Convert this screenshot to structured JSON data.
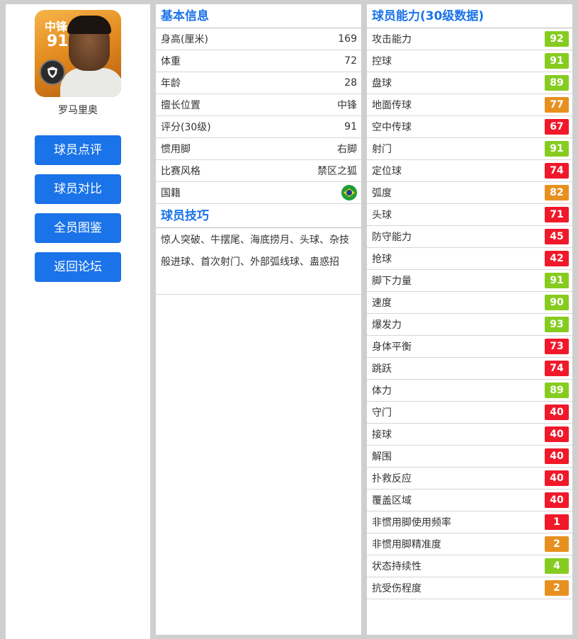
{
  "player": {
    "position": "中锋",
    "rating": "91",
    "name": "罗马里奥"
  },
  "nav": [
    {
      "label": "球员点评"
    },
    {
      "label": "球员对比"
    },
    {
      "label": "全员图鉴"
    },
    {
      "label": "返回论坛"
    }
  ],
  "basic": {
    "title": "基本信息",
    "rows": [
      {
        "label": "身高(厘米)",
        "value": "169"
      },
      {
        "label": "体重",
        "value": "72"
      },
      {
        "label": "年龄",
        "value": "28"
      },
      {
        "label": "擅长位置",
        "value": "中锋"
      },
      {
        "label": "评分(30级)",
        "value": "91"
      },
      {
        "label": "惯用脚",
        "value": "右脚"
      },
      {
        "label": "比赛风格",
        "value": "禁区之狐"
      },
      {
        "label": "国籍",
        "value": ""
      }
    ]
  },
  "skills": {
    "title": "球员技巧",
    "text": "惊人突破、牛摆尾、海底捞月、头球、杂技般进球、首次射门、外部弧线球、蛊惑招"
  },
  "abilities": {
    "title": "球员能力(30级数据)",
    "colors": {
      "green": "#86cc20",
      "orange": "#e8901f",
      "red": "#f1182a"
    },
    "rows": [
      {
        "label": "攻击能力",
        "value": "92",
        "color": "green"
      },
      {
        "label": "控球",
        "value": "91",
        "color": "green"
      },
      {
        "label": "盘球",
        "value": "89",
        "color": "green"
      },
      {
        "label": "地面传球",
        "value": "77",
        "color": "orange"
      },
      {
        "label": "空中传球",
        "value": "67",
        "color": "red"
      },
      {
        "label": "射门",
        "value": "91",
        "color": "green"
      },
      {
        "label": "定位球",
        "value": "74",
        "color": "red"
      },
      {
        "label": "弧度",
        "value": "82",
        "color": "orange"
      },
      {
        "label": "头球",
        "value": "71",
        "color": "red"
      },
      {
        "label": "防守能力",
        "value": "45",
        "color": "red"
      },
      {
        "label": "抢球",
        "value": "42",
        "color": "red"
      },
      {
        "label": "脚下力量",
        "value": "91",
        "color": "green"
      },
      {
        "label": "速度",
        "value": "90",
        "color": "green"
      },
      {
        "label": "爆发力",
        "value": "93",
        "color": "green"
      },
      {
        "label": "身体平衡",
        "value": "73",
        "color": "red"
      },
      {
        "label": "跳跃",
        "value": "74",
        "color": "red"
      },
      {
        "label": "体力",
        "value": "89",
        "color": "green"
      },
      {
        "label": "守门",
        "value": "40",
        "color": "red"
      },
      {
        "label": "接球",
        "value": "40",
        "color": "red"
      },
      {
        "label": "解围",
        "value": "40",
        "color": "red"
      },
      {
        "label": "扑救反应",
        "value": "40",
        "color": "red"
      },
      {
        "label": "覆盖区域",
        "value": "40",
        "color": "red"
      },
      {
        "label": "非惯用脚使用频率",
        "value": "1",
        "color": "red"
      },
      {
        "label": "非惯用脚精准度",
        "value": "2",
        "color": "orange"
      },
      {
        "label": "状态持续性",
        "value": "4",
        "color": "green"
      },
      {
        "label": "抗受伤程度",
        "value": "2",
        "color": "orange"
      }
    ]
  }
}
